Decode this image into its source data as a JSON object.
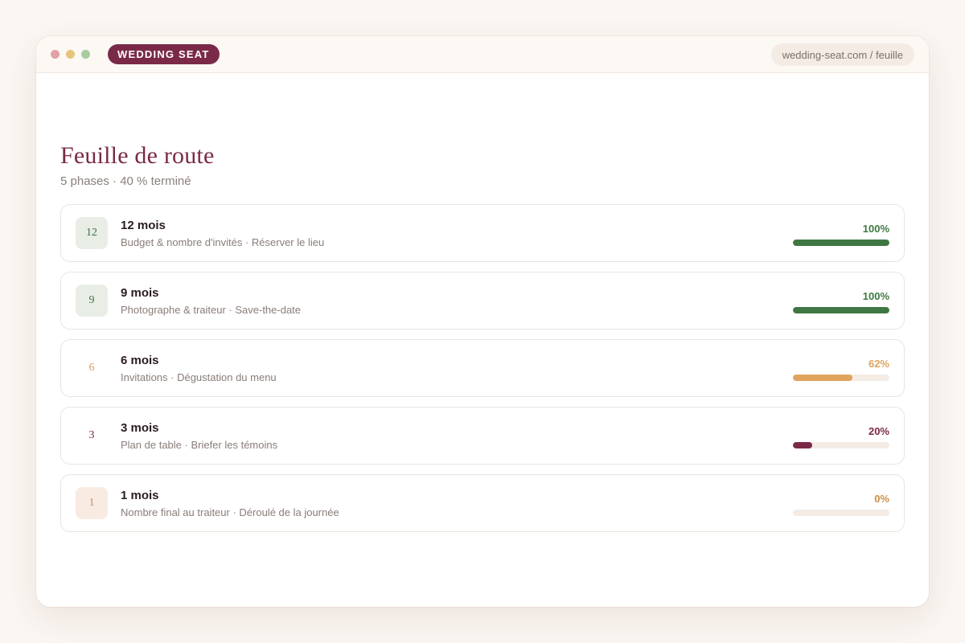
{
  "window": {
    "brand_label": "WEDDING SEAT",
    "url": "wedding-seat.com / feuille",
    "dots": [
      "#e3a1a6",
      "#e7c57e",
      "#a6cda2"
    ]
  },
  "page": {
    "title": "Feuille de route",
    "subtitle": "5 phases · 40 % terminé"
  },
  "phases": [
    {
      "badge": "12",
      "title": "12 mois",
      "description": "Budget & nombre d'invités · Réserver le lieu",
      "percent_label": "100%",
      "progress": 1.0,
      "badge_bg": "#e8eee6",
      "badge_color": "#3f6e44",
      "accent": "#3e7742"
    },
    {
      "badge": "9",
      "title": "9 mois",
      "description": "Photographe & traiteur · Save-the-date",
      "percent_label": "100%",
      "progress": 1.0,
      "badge_bg": "#e8eee6",
      "badge_color": "#3f6e44",
      "accent": "#3e7742"
    },
    {
      "badge": "6",
      "title": "6 mois",
      "description": "Invitations · Dégustation du menu",
      "percent_label": "62%",
      "progress": 0.62,
      "badge_bg": "#ffffff",
      "badge_color": "#d99b58",
      "accent": "#e0a45e"
    },
    {
      "badge": "3",
      "title": "3 mois",
      "description": "Plan de table · Briefer les témoins",
      "percent_label": "20%",
      "progress": 0.2,
      "badge_bg": "#ffffff",
      "badge_color": "#7a2a48",
      "accent": "#7a2a48"
    },
    {
      "badge": "1",
      "title": "1 mois",
      "description": "Nombre final au traiteur · Déroulé de la journée",
      "percent_label": "0%",
      "progress": 0.0,
      "badge_bg": "#f8ebe2",
      "badge_color": "#c98f6a",
      "accent": "#c9904a"
    }
  ]
}
